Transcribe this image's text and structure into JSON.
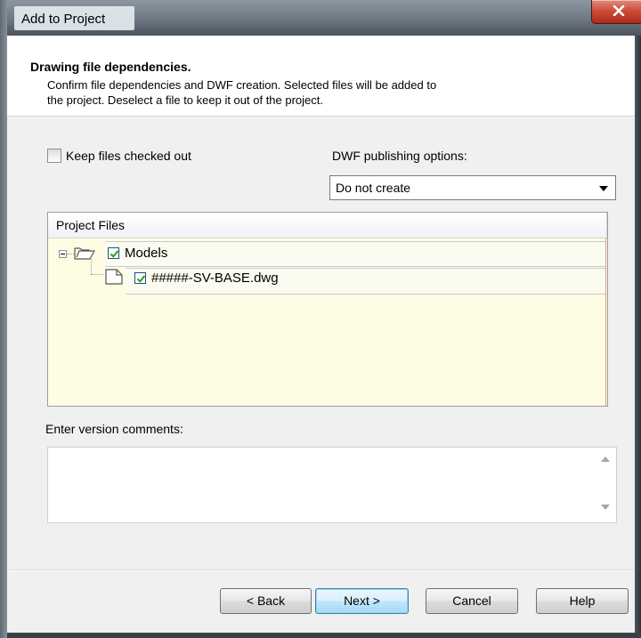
{
  "window": {
    "title": "Add to Project"
  },
  "header": {
    "title": "Drawing file dependencies.",
    "description_line1": "Confirm file dependencies and DWF creation. Selected files will be added to",
    "description_line2": "the project. Deselect a file to keep it out of the project."
  },
  "options": {
    "keep_checked_out_label": "Keep files checked out",
    "keep_checked_out": false,
    "dwf_label": "DWF publishing options:",
    "dwf_selected": "Do not create"
  },
  "tree": {
    "column_header": "Project Files",
    "items": [
      {
        "label": "Models",
        "checked": true,
        "type": "folder",
        "expanded": true
      },
      {
        "label": "#####-SV-BASE.dwg",
        "checked": true,
        "type": "file"
      }
    ]
  },
  "comments": {
    "label": "Enter version comments:",
    "value": ""
  },
  "buttons": {
    "back": "< Back",
    "next": "Next >",
    "cancel": "Cancel",
    "help": "Help"
  },
  "colors": {
    "tree_background": "#fefde3",
    "close_button": "#c94a36",
    "check_mark": "#2a9d1a"
  }
}
